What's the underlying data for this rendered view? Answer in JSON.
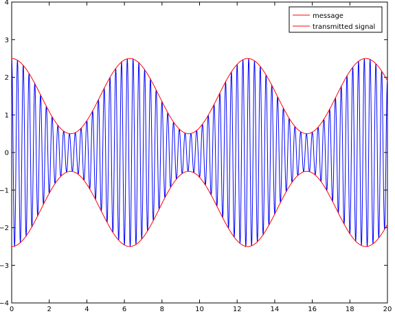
{
  "chart_data": {
    "type": "line",
    "title": "",
    "xlabel": "",
    "ylabel": "",
    "xlim": [
      0,
      20
    ],
    "ylim": [
      -4,
      4
    ],
    "xticks": [
      "0",
      "2",
      "4",
      "6",
      "8",
      "10",
      "12",
      "14",
      "16",
      "18",
      "20"
    ],
    "yticks": [
      "4",
      "3",
      "2",
      "1",
      "0",
      "−1",
      "−2",
      "−3",
      "−4"
    ],
    "grid": false,
    "legend_position": "top-right",
    "series": [
      {
        "name": "message",
        "color": "#ff0000",
        "description_formula": "±(1.5 + cos(x))",
        "x": [
          0,
          1,
          2,
          3,
          3.14,
          4,
          5,
          6,
          6.28,
          7,
          8,
          9,
          9.42,
          10,
          11,
          12,
          12.57,
          13,
          14,
          15,
          15.71,
          16,
          17,
          18,
          18.85,
          19,
          20
        ],
        "values": [
          2.5,
          2.04,
          1.08,
          0.51,
          0.5,
          0.85,
          1.78,
          2.46,
          2.5,
          2.25,
          1.35,
          0.59,
          0.5,
          0.66,
          1.5,
          2.34,
          2.5,
          2.41,
          1.64,
          0.74,
          0.5,
          0.54,
          1.22,
          2.16,
          2.5,
          2.49,
          1.91
        ]
      },
      {
        "name": "transmitted signal",
        "color": "#0000ff",
        "envelope": "1.5 + cos(x)",
        "carrier_cycles": 65,
        "x_range": [
          0,
          20
        ]
      }
    ]
  }
}
